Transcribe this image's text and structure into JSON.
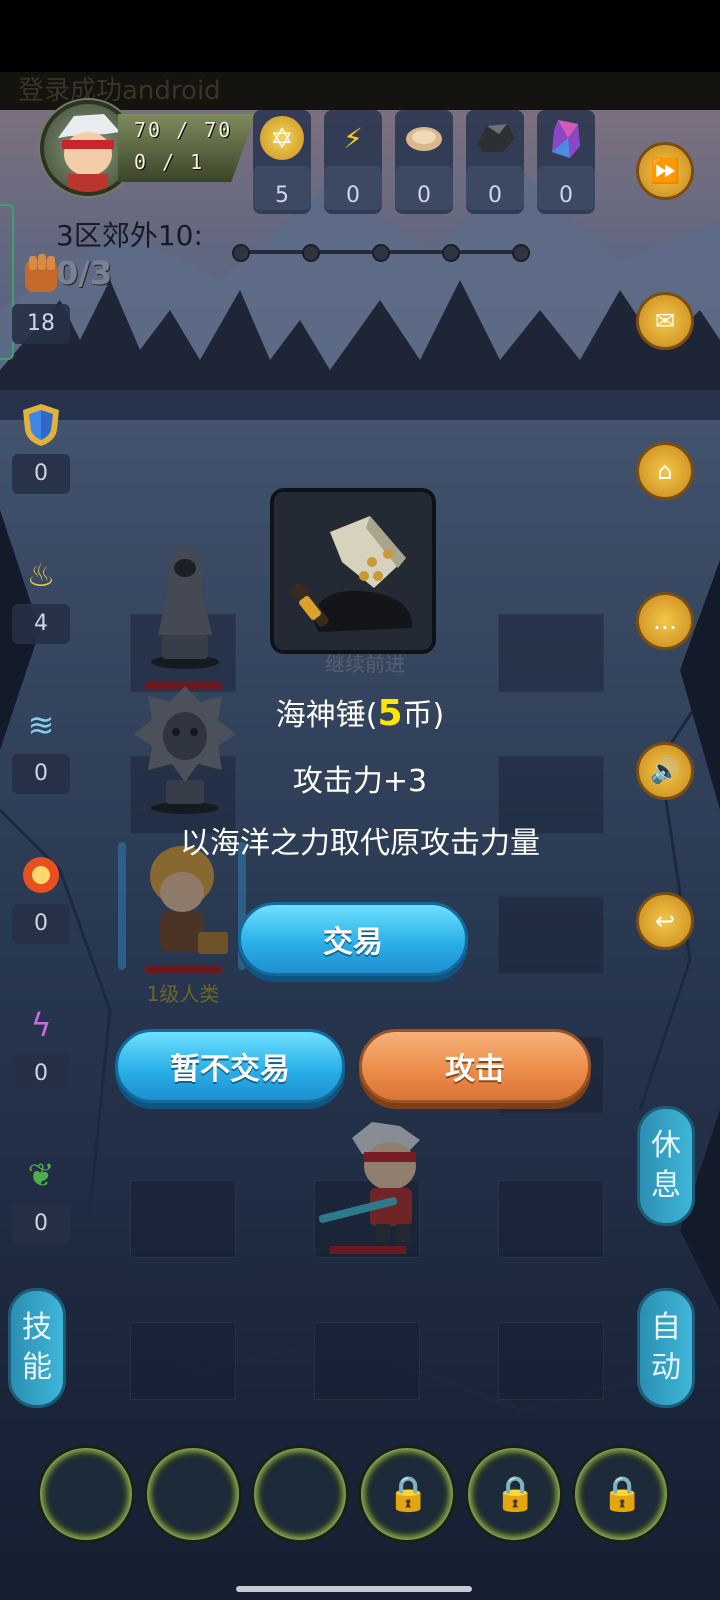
{
  "ghost_text": "登录成功android",
  "hero": {
    "hp": "70 / 70",
    "exp": "0 / 1"
  },
  "resources": [
    {
      "icon": "gold-coin-icon",
      "value": "5"
    },
    {
      "icon": "lightning-icon",
      "value": "0"
    },
    {
      "icon": "bread-icon",
      "value": "0"
    },
    {
      "icon": "ore-icon",
      "value": "0"
    },
    {
      "icon": "crystal-icon",
      "value": "0"
    }
  ],
  "stage": {
    "name": "3区郊外10:",
    "progress": "0/3"
  },
  "skills": [
    {
      "icon": "fist-icon",
      "value": "18"
    },
    {
      "icon": "shield-icon",
      "value": "0"
    },
    {
      "icon": "holy-light-icon",
      "value": "4"
    },
    {
      "icon": "wind-icon",
      "value": "0"
    },
    {
      "icon": "fire-icon",
      "value": "0"
    },
    {
      "icon": "lightning-rune-icon",
      "value": "0"
    },
    {
      "icon": "vine-icon",
      "value": "0"
    }
  ],
  "board": {
    "player_label": "1级人类",
    "ghost_label": "继续前进"
  },
  "dialog": {
    "item_name": "海神锤(",
    "price": "5",
    "currency": "币)",
    "stat": "攻击力+3",
    "description": "以海洋之力取代原攻击力量",
    "trade_label": "交易",
    "decline_label": "暂不交易",
    "attack_label": "攻击"
  },
  "side": {
    "rest_label": [
      "休",
      "息"
    ],
    "auto_label": [
      "自",
      "动"
    ],
    "skill_label": [
      "技",
      "能"
    ]
  },
  "colors": {
    "gold": "#f3c84a",
    "blue_button": "#2ab0e8",
    "orange_button": "#ec8d4b",
    "price_highlight": "#ffe600"
  }
}
